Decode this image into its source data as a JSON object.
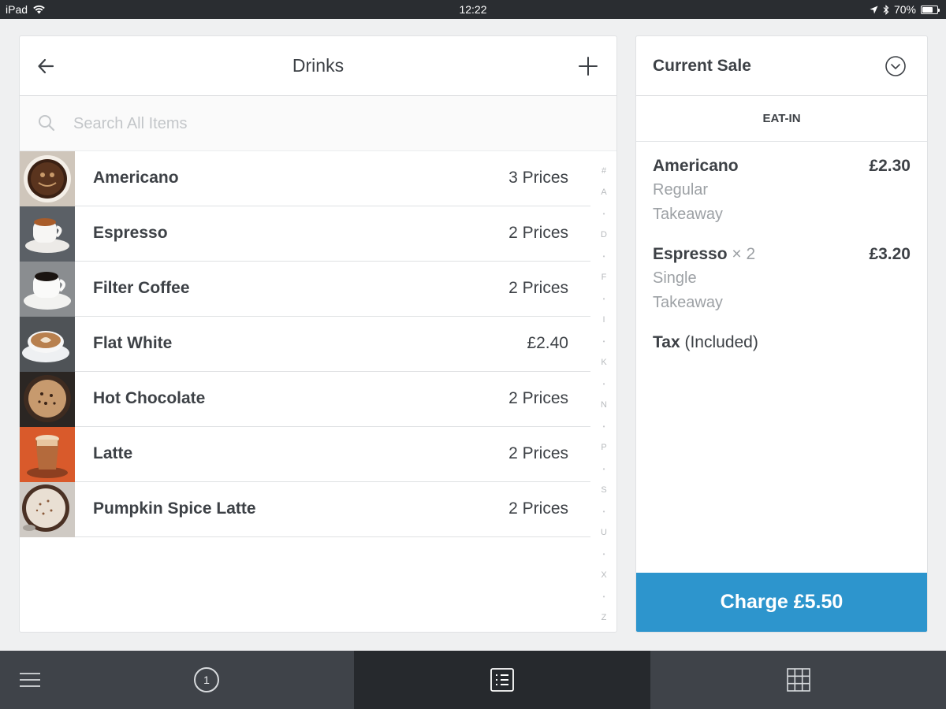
{
  "status_bar": {
    "device": "iPad",
    "time": "12:22",
    "battery": "70%",
    "battery_level": 0.7
  },
  "library": {
    "title": "Drinks",
    "search_placeholder": "Search All Items",
    "items": [
      {
        "name": "Americano",
        "price": "3 Prices",
        "thumb": "cup-top-view"
      },
      {
        "name": "Espresso",
        "price": "2 Prices",
        "thumb": "espresso-cup"
      },
      {
        "name": "Filter Coffee",
        "price": "2 Prices",
        "thumb": "black-coffee-cup"
      },
      {
        "name": "Flat White",
        "price": "£2.40",
        "thumb": "latte-art-cup"
      },
      {
        "name": "Hot Chocolate",
        "price": "2 Prices",
        "thumb": "hot-chocolate-cup"
      },
      {
        "name": "Latte",
        "price": "2 Prices",
        "thumb": "latte-glass"
      },
      {
        "name": "Pumpkin Spice Latte",
        "price": "2 Prices",
        "thumb": "spice-latte-cup"
      }
    ],
    "index_letters": [
      "#",
      "A",
      "•",
      "D",
      "•",
      "F",
      "•",
      "I",
      "•",
      "K",
      "•",
      "N",
      "•",
      "P",
      "•",
      "S",
      "•",
      "U",
      "•",
      "X",
      "•",
      "Z"
    ]
  },
  "sale": {
    "title": "Current Sale",
    "mode": "EAT-IN",
    "lines": [
      {
        "name": "Americano",
        "qty": "",
        "price": "£2.30",
        "mods": [
          "Regular",
          "Takeaway"
        ]
      },
      {
        "name": "Espresso",
        "qty": " × 2",
        "price": "£3.20",
        "mods": [
          "Single",
          "Takeaway"
        ]
      }
    ],
    "tax_label": "Tax",
    "tax_note": " (Included)",
    "charge_label": "Charge £5.50"
  },
  "bottom_nav": {
    "open_tickets_count": "1"
  },
  "colors": {
    "accent": "#2d95cd",
    "nav_bg": "#3f4349",
    "nav_active_bg": "#26292d",
    "status_bar_bg": "#2a2d31"
  }
}
